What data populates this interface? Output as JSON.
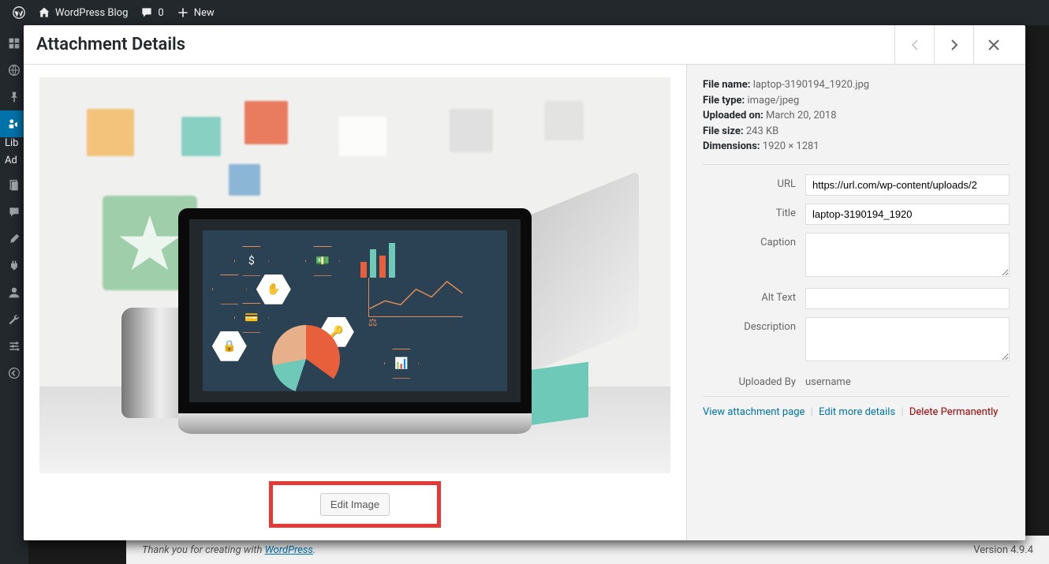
{
  "adminbar": {
    "site_name": "WordPress Blog",
    "comments_count": "0",
    "new_label": "New"
  },
  "sidebar": {
    "labels": {
      "library": "Lib",
      "add_new": "Ad"
    }
  },
  "modal": {
    "title": "Attachment Details",
    "meta": {
      "file_name_label": "File name:",
      "file_name": "laptop-3190194_1920.jpg",
      "file_type_label": "File type:",
      "file_type": "image/jpeg",
      "uploaded_on_label": "Uploaded on:",
      "uploaded_on": "March 20, 2018",
      "file_size_label": "File size:",
      "file_size": "243 KB",
      "dimensions_label": "Dimensions:",
      "dimensions": "1920 × 1281"
    },
    "fields": {
      "url_label": "URL",
      "url_value": "https://url.com/wp-content/uploads/2",
      "title_label": "Title",
      "title_value": "laptop-3190194_1920",
      "caption_label": "Caption",
      "caption_value": "",
      "alt_label": "Alt Text",
      "alt_value": "",
      "description_label": "Description",
      "description_value": "",
      "uploaded_by_label": "Uploaded By",
      "uploaded_by_value": "username"
    },
    "actions": {
      "view": "View attachment page",
      "edit_more": "Edit more details",
      "delete": "Delete Permanently"
    },
    "edit_image_label": "Edit Image"
  },
  "footer": {
    "thank_you_prefix": "Thank you for creating with ",
    "thank_you_link": "WordPress",
    "thank_you_suffix": ".",
    "version": "Version 4.9.4"
  }
}
